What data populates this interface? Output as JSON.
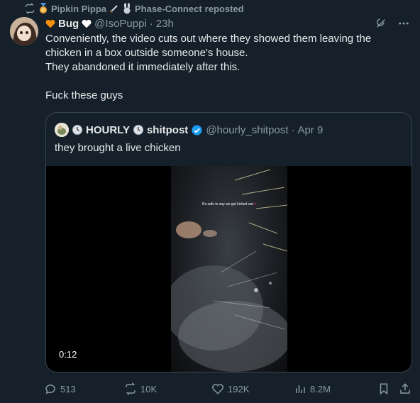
{
  "repost": {
    "user": "Pipkin Pippa",
    "second_user": "Phase-Connect",
    "suffix": "reposted"
  },
  "author": {
    "name": "Bug",
    "handle": "@IsoPuppi",
    "time": "23h"
  },
  "tweet_text": "Conveniently, the video cuts out where they showed them leaving the\nchicken in a box outside someone's house.\nThey abandoned it immediately after this.\n\nFuck these guys",
  "quote": {
    "name_part1": "HOURLY",
    "name_part2": "shitpost",
    "handle": "@hourly_shitpost",
    "date": "Apr 9",
    "text": "they brought a live chicken",
    "video_caption": "It's safe to say we got kicked out",
    "duration": "0:12"
  },
  "actions": {
    "replies": "513",
    "reposts": "10K",
    "likes": "192K",
    "views": "8.2M"
  },
  "colors": {
    "background": "#15202b",
    "muted": "#8b98a5",
    "border": "#38444d",
    "verified": "#1d9bf0"
  }
}
